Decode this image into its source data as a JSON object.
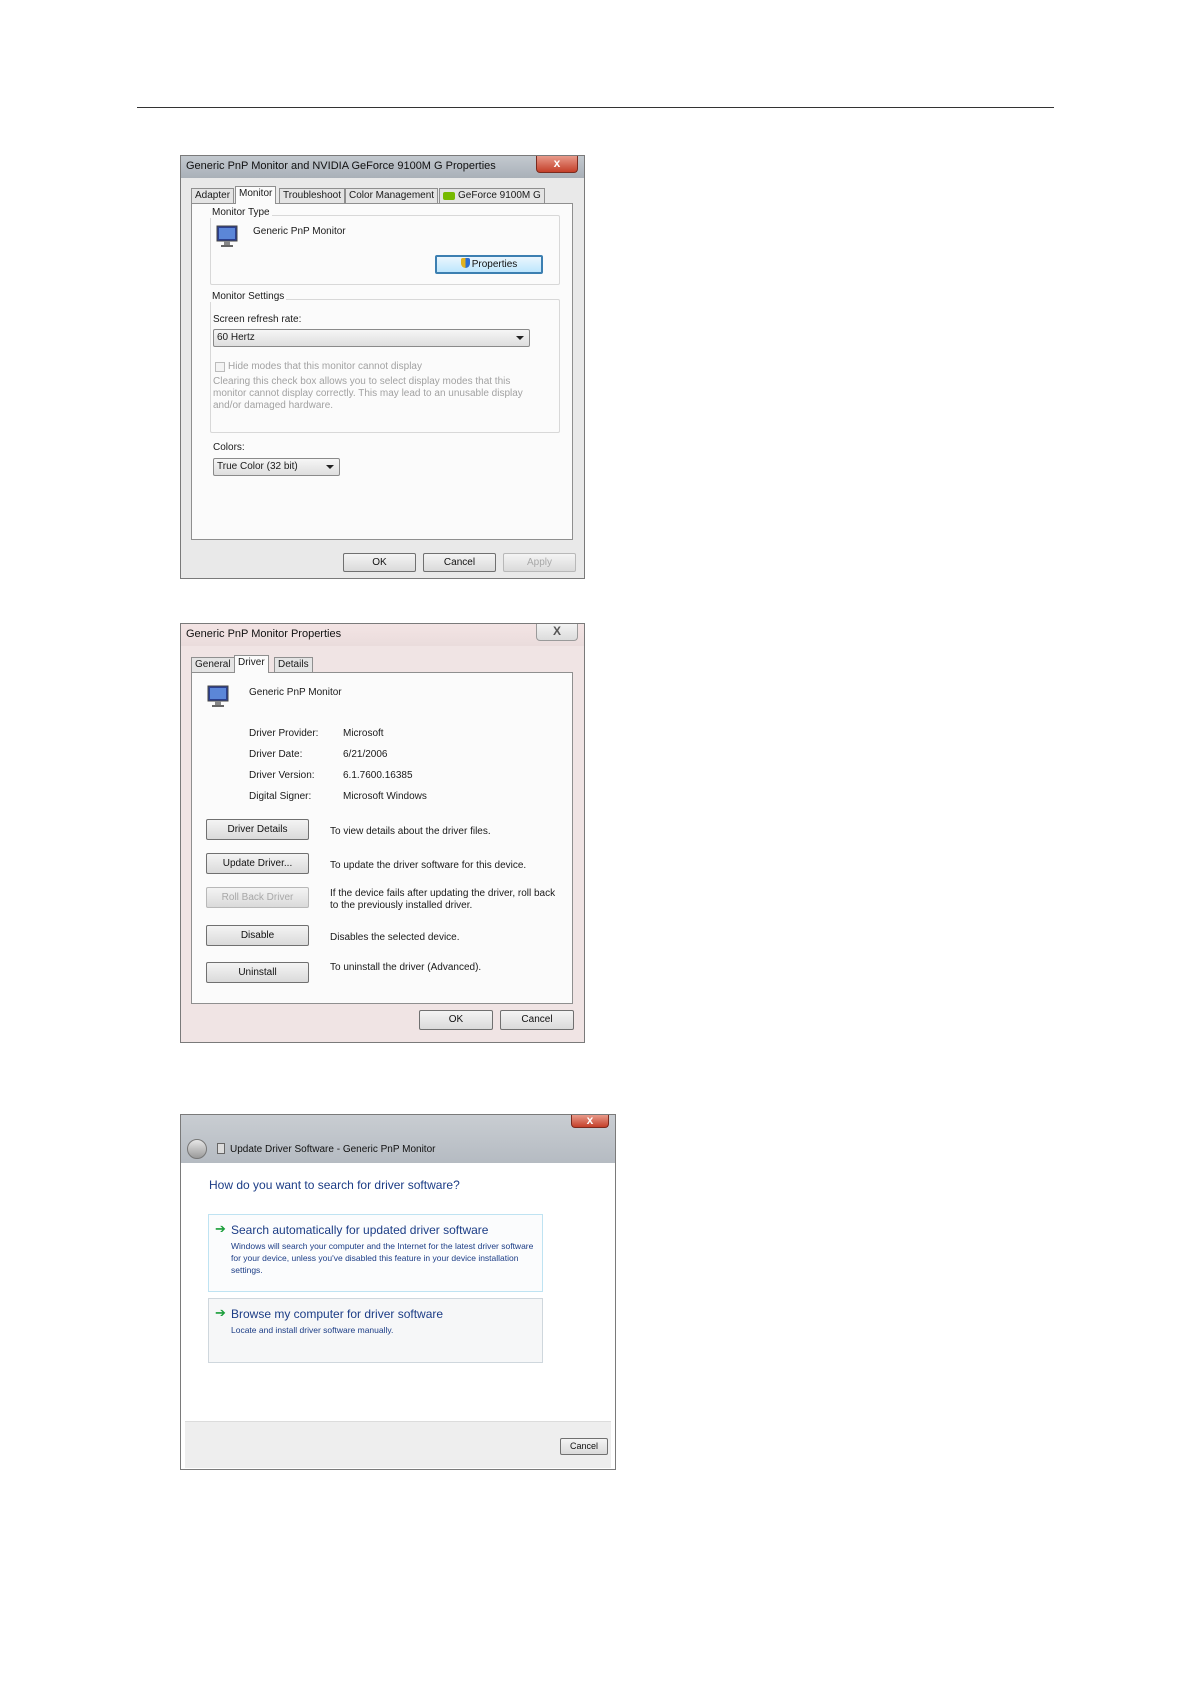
{
  "dialog1": {
    "title": "Generic PnP Monitor and NVIDIA GeForce 9100M G   Properties",
    "close": "x",
    "tabs": [
      "Adapter",
      "Monitor",
      "Troubleshoot",
      "Color Management",
      "GeForce 9100M G"
    ],
    "active_tab": "Monitor",
    "monitor_type_label": "Monitor Type",
    "monitor_name": "Generic PnP Monitor",
    "properties_button": "Properties",
    "monitor_settings_label": "Monitor Settings",
    "refresh_label": "Screen refresh rate:",
    "refresh_value": "60 Hertz",
    "hide_modes_label": "Hide modes that this monitor cannot display",
    "hide_modes_desc": "Clearing this check box allows you to select display modes that this monitor cannot display correctly. This may lead to an unusable display and/or damaged hardware.",
    "colors_label": "Colors:",
    "colors_value": "True Color (32 bit)",
    "ok": "OK",
    "cancel": "Cancel",
    "apply": "Apply"
  },
  "dialog2": {
    "title": "Generic PnP Monitor Properties",
    "close": "X",
    "tabs": [
      "General",
      "Driver",
      "Details"
    ],
    "active_tab": "Driver",
    "device_name": "Generic PnP Monitor",
    "info": [
      {
        "label": "Driver Provider:",
        "value": "Microsoft"
      },
      {
        "label": "Driver Date:",
        "value": "6/21/2006"
      },
      {
        "label": "Driver Version:",
        "value": "6.1.7600.16385"
      },
      {
        "label": "Digital Signer:",
        "value": "Microsoft Windows"
      }
    ],
    "actions": [
      {
        "button": "Driver Details",
        "desc": "To view details about the driver files."
      },
      {
        "button": "Update Driver...",
        "desc": "To update the driver software for this device."
      },
      {
        "button": "Roll Back Driver",
        "desc": "If the device fails after updating the driver, roll back to the previously installed driver."
      },
      {
        "button": "Disable",
        "desc": "Disables the selected device."
      },
      {
        "button": "Uninstall",
        "desc": "To uninstall the driver (Advanced)."
      }
    ],
    "ok": "OK",
    "cancel": "Cancel"
  },
  "dialog3": {
    "title": "Update Driver Software - Generic PnP Monitor",
    "close": "x",
    "question": "How do you want to search for driver software?",
    "option1_title": "Search automatically for updated driver software",
    "option1_desc": "Windows will search your computer and the Internet for the latest driver software for your device, unless you've disabled this feature in your device installation settings.",
    "option2_title": "Browse my computer for driver software",
    "option2_desc": "Locate and install driver software manually.",
    "cancel": "Cancel"
  },
  "colors": {
    "link_blue": "#1c3d86",
    "green_arrow": "#1a9e3a",
    "close_red": "#c4402a"
  }
}
